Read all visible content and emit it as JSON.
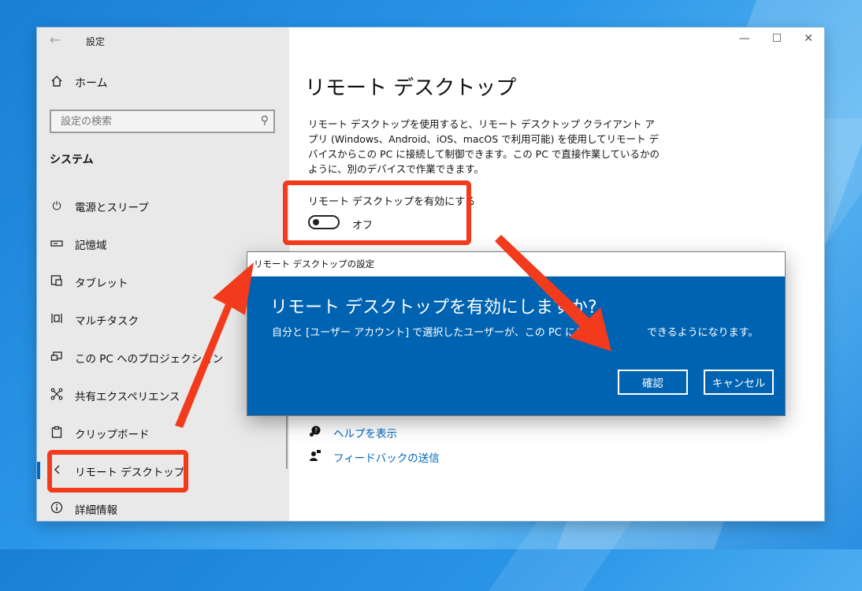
{
  "window": {
    "app_title": "設定",
    "win_controls": [
      "—",
      "☐",
      "✕"
    ]
  },
  "sidebar": {
    "home_label": "ホーム",
    "search_placeholder": "設定の検索",
    "section_label": "システム",
    "items": [
      {
        "label": "電源とスリープ",
        "icon": "power-icon"
      },
      {
        "label": "記憶域",
        "icon": "storage-icon"
      },
      {
        "label": "タブレット",
        "icon": "tablet-icon"
      },
      {
        "label": "マルチタスク",
        "icon": "multitask-icon"
      },
      {
        "label": "この PC へのプロジェクション",
        "icon": "projection-icon"
      },
      {
        "label": "共有エクスペリエンス",
        "icon": "shared-experience-icon"
      },
      {
        "label": "クリップボード",
        "icon": "clipboard-icon"
      },
      {
        "label": "リモート デスクトップ",
        "icon": "remote-desktop-icon",
        "selected": true
      },
      {
        "label": "詳細情報",
        "icon": "info-icon"
      }
    ]
  },
  "content": {
    "page_title": "リモート デスクトップ",
    "description": "リモート デスクトップを使用すると、リモート デスクトップ クライアント アプリ (Windows、Android、iOS、macOS で利用可能) を使用してリモート デバイスからこの PC に接続して制御できます。この PC で直接作業しているかのように、別のデバイスで作業できます。",
    "toggle_label": "リモート デスクトップを有効にする",
    "toggle_state": "オフ",
    "help_link": "ヘルプを表示",
    "feedback_link": "フィードバックの送信"
  },
  "dialog": {
    "title": "リモート デスクトップの設定",
    "heading": "リモート デスクトップを有効にしますか?",
    "body": "自分と [ユーザー アカウント] で選択したユーザーが、この PC にリモー　　　　できるようになります。",
    "confirm_label": "確認",
    "cancel_label": "キャンセル"
  },
  "colors": {
    "accent": "#0067c0",
    "dialog_bg": "#0063b1",
    "highlight": "#f23a1c",
    "sidebar_bg": "#e9e9e9"
  }
}
